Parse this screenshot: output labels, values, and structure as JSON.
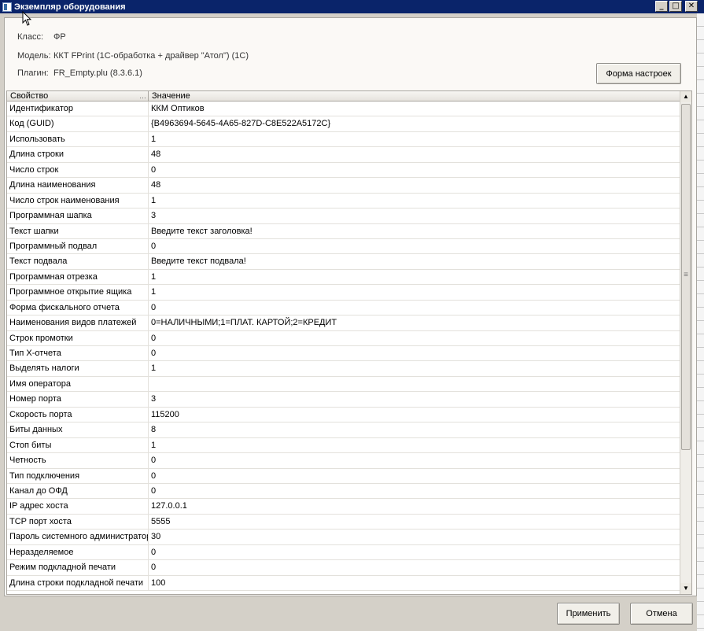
{
  "window": {
    "title": "Экземпляр оборудования"
  },
  "info": {
    "class_label": "Класс:",
    "class_value": "ФР",
    "model_label": "Модель:",
    "model_value": "ККТ FPrint (1С-обработка + драйвер \"Атол\") (1С)",
    "plugin_label": "Плагин:",
    "plugin_value": "FR_Empty.plu (8.3.6.1)"
  },
  "buttons": {
    "settings_form": "Форма настроек",
    "apply": "Применить",
    "cancel": "Отмена"
  },
  "grid": {
    "headers": {
      "property": "Свойство",
      "value": "Значение"
    },
    "rows": [
      {
        "property": "Идентификатор",
        "value": "ККМ Оптиков"
      },
      {
        "property": "Код (GUID)",
        "value": "{B4963694-5645-4A65-827D-C8E522A5172C}"
      },
      {
        "property": "Использовать",
        "value": "1"
      },
      {
        "property": "Длина строки",
        "value": "48"
      },
      {
        "property": "Число строк",
        "value": "0"
      },
      {
        "property": "Длина наименования",
        "value": "48"
      },
      {
        "property": "Число строк наименования",
        "value": "1"
      },
      {
        "property": "Программная шапка",
        "value": "3"
      },
      {
        "property": "Текст шапки",
        "value": "Введите текст заголовка!"
      },
      {
        "property": "Программный подвал",
        "value": "0"
      },
      {
        "property": "Текст подвала",
        "value": "Введите текст подвала!"
      },
      {
        "property": "Программная отрезка",
        "value": "1"
      },
      {
        "property": "Программное открытие ящика",
        "value": "1"
      },
      {
        "property": "Форма фискального отчета",
        "value": "0"
      },
      {
        "property": "Наименования видов платежей",
        "value": "0=НАЛИЧНЫМИ;1=ПЛАТ. КАРТОЙ;2=КРЕДИТ"
      },
      {
        "property": "Строк промотки",
        "value": "0"
      },
      {
        "property": "Тип Х-отчета",
        "value": "0"
      },
      {
        "property": "Выделять налоги",
        "value": "1"
      },
      {
        "property": "Имя оператора",
        "value": ""
      },
      {
        "property": "Номер порта",
        "value": "3"
      },
      {
        "property": "Скорость порта",
        "value": "115200"
      },
      {
        "property": "Биты данных",
        "value": "8"
      },
      {
        "property": "Стоп биты",
        "value": "1"
      },
      {
        "property": "Четность",
        "value": "0"
      },
      {
        "property": "Тип подключения",
        "value": "0"
      },
      {
        "property": "Канал до ОФД",
        "value": "0"
      },
      {
        "property": "IP адрес хоста",
        "value": "127.0.0.1"
      },
      {
        "property": "TCP порт хоста",
        "value": "5555"
      },
      {
        "property": "Пароль системного администратора",
        "value": "30"
      },
      {
        "property": "Неразделяемое",
        "value": "0"
      },
      {
        "property": "Режим подкладной печати",
        "value": "0"
      },
      {
        "property": "Длина строки подкладной печати",
        "value": "100"
      }
    ]
  }
}
